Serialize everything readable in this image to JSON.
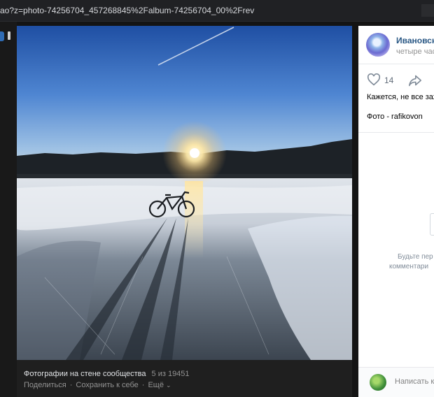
{
  "browser": {
    "url": "ao?z=photo-74256704_457268845%2Falbum-74256704_00%2Frev"
  },
  "viewer": {
    "caption_title": "Фотографии на стене сообщества",
    "counter": "5 из 19451",
    "actions": {
      "share": "Поделиться",
      "save": "Сохранить к себе",
      "more": "Ещё",
      "separator": "·"
    }
  },
  "side": {
    "group_name": "Ивановско",
    "post_time": "четыре час",
    "likes": "14",
    "post_text": "Кажется, не все зах",
    "photo_credit": "Фото - rafikovon",
    "empty_comments_line1": "Будьте пер",
    "empty_comments_line2": "комментари",
    "comment_placeholder": "Написать к"
  },
  "icons": {
    "like": "heart-icon",
    "share": "share-arrow-icon",
    "more": "chevron-down-icon"
  },
  "colors": {
    "link": "#2a5885",
    "muted": "#939393",
    "viewer_bg": "#1f1f1f"
  }
}
